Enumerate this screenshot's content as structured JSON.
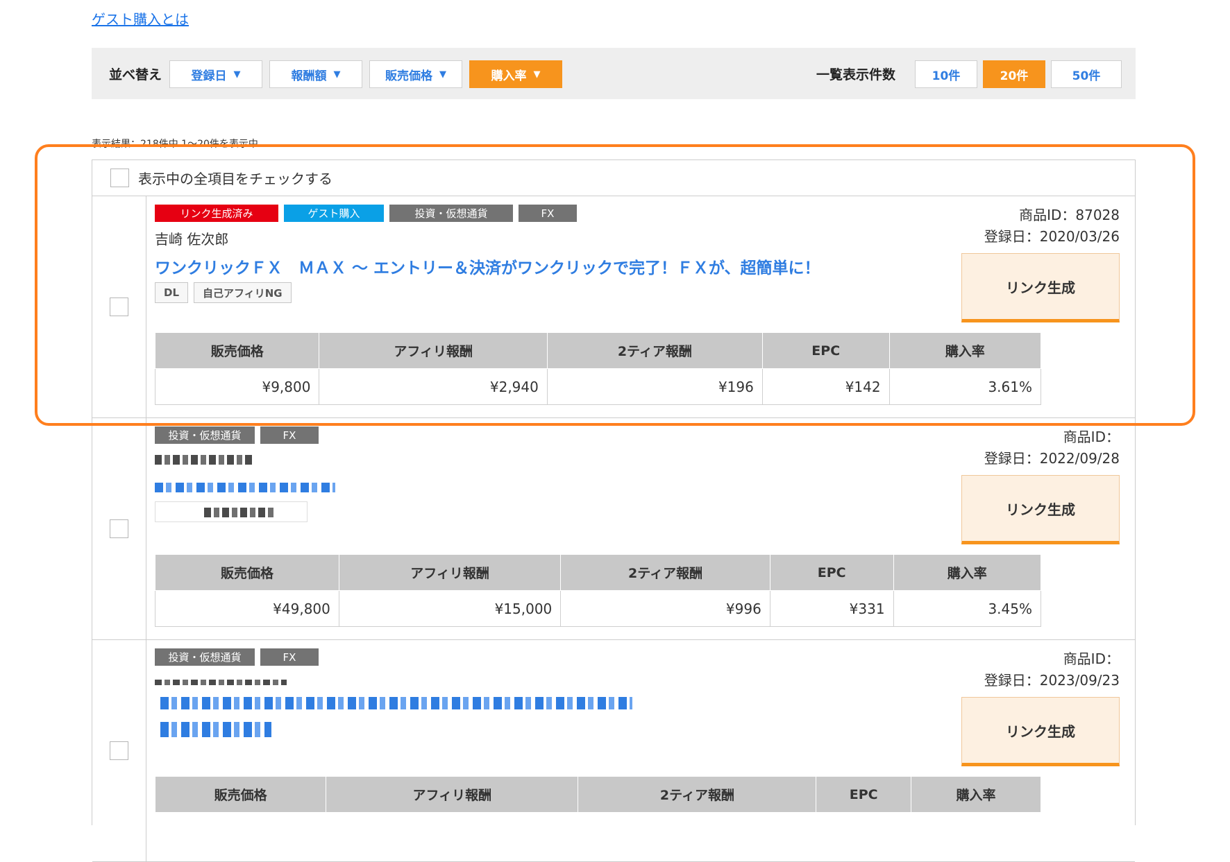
{
  "guest_link": "ゲスト購入とは",
  "sort": {
    "label": "並べ替え",
    "buttons": [
      {
        "label": "登録日"
      },
      {
        "label": "報酬額"
      },
      {
        "label": "販売価格"
      },
      {
        "label": "購入率"
      }
    ],
    "active_index": 3,
    "count_label": "一覧表示件数",
    "count_options": [
      "10件",
      "20件",
      "50件"
    ],
    "count_active_index": 1
  },
  "results_text": "表示結果：218件中 1〜20件を表示中",
  "check_all_label": "表示中の全項目をチェックする",
  "stat_headers": [
    "販売価格",
    "アフィリ報酬",
    "2ティア報酬",
    "EPC",
    "購入率"
  ],
  "items": [
    {
      "tags": [
        "リンク生成済み",
        "ゲスト購入",
        "投資・仮想通貨",
        "FX"
      ],
      "author": "吉崎 佐次郎",
      "title": "ワンクリックＦＸ　ＭＡＸ 〜 エントリー＆決済がワンクリックで完了！ＦＸが、超簡単に！",
      "subtags": [
        "DL",
        "自己アフィリNG"
      ],
      "product_id": "商品ID：87028",
      "registered": "登録日：2020/03/26",
      "link_button": "リンク生成",
      "stats": [
        "¥9,800",
        "¥2,940",
        "¥196",
        "¥142",
        "3.61%"
      ]
    },
    {
      "tags": [
        "投資・仮想通貨",
        "FX"
      ],
      "product_id": "商品ID：",
      "registered": "登録日：2022/09/28",
      "link_button": "リンク生成",
      "stats": [
        "¥49,800",
        "¥15,000",
        "¥996",
        "¥331",
        "3.45%"
      ]
    },
    {
      "tags": [
        "投資・仮想通貨",
        "FX"
      ],
      "product_id": "商品ID：",
      "registered": "登録日：2023/09/23",
      "link_button": "リンク生成"
    }
  ],
  "colors": {
    "accent": "#f7941d",
    "link": "#2f7de1",
    "highlight": "#ff7f1e",
    "tag_red": "#e60012",
    "tag_blue": "#0aa0e6",
    "tag_gray": "#737373"
  }
}
